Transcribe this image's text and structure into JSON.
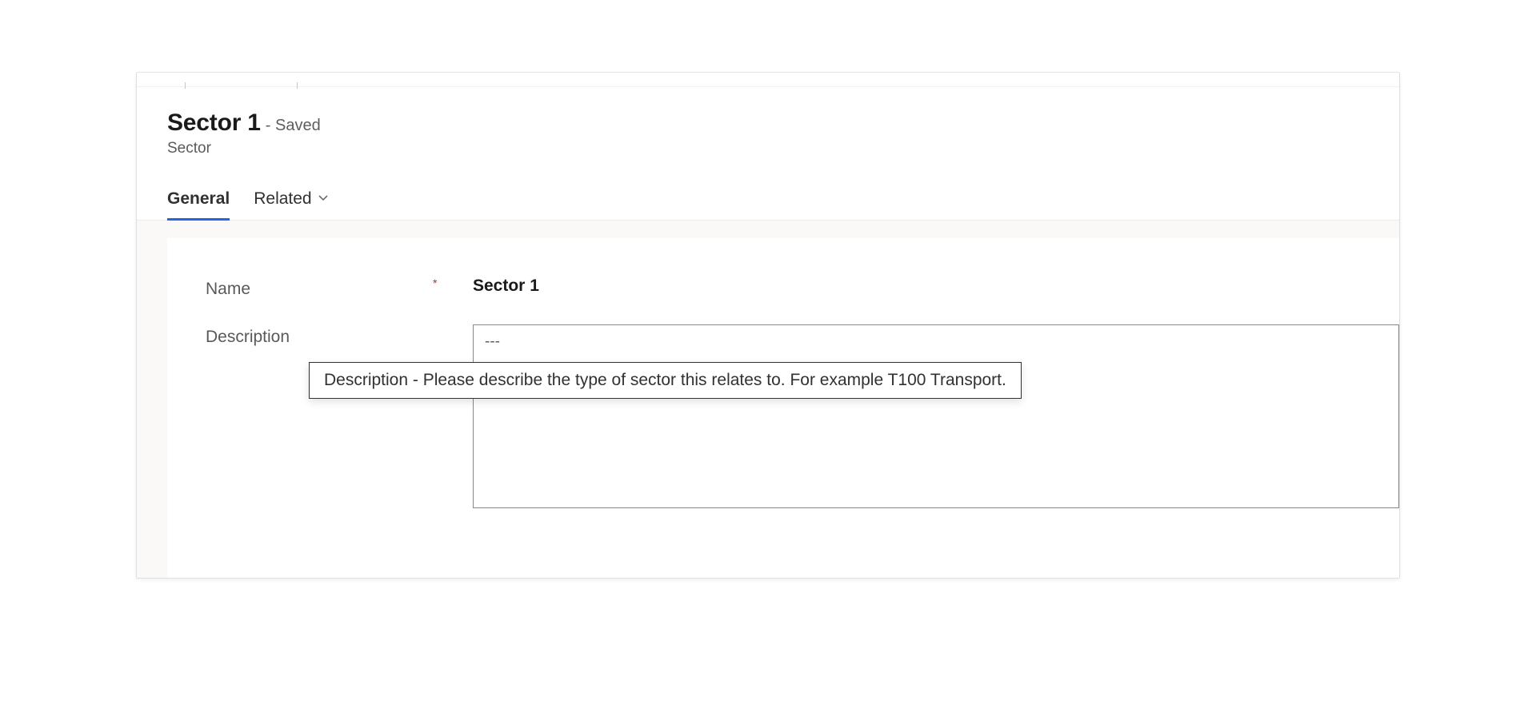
{
  "header": {
    "record_title": "Sector 1",
    "save_status": "- Saved",
    "entity_name": "Sector"
  },
  "tabs": {
    "general": "General",
    "related": "Related"
  },
  "form": {
    "name_label": "Name",
    "name_value": "Sector 1",
    "description_label": "Description",
    "description_value": "---",
    "description_tooltip": "Description - Please describe the type of sector this relates to. For example T100 Transport."
  }
}
